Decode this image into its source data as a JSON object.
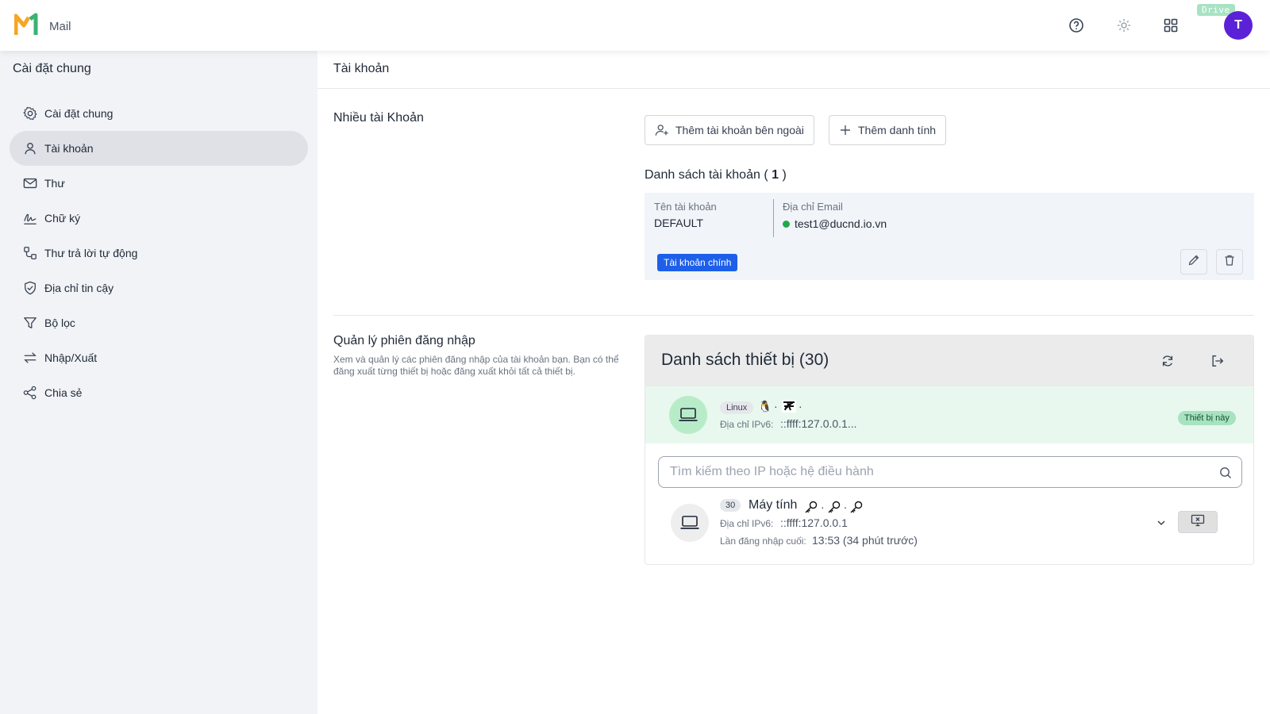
{
  "app": {
    "name": "Mail",
    "drive_badge": "Drive",
    "avatar_letter": "T",
    "brand_orange": "#f5a623",
    "brand_green": "#3bb273",
    "avatar_color": "#5b21d6"
  },
  "topbar": {
    "icons": [
      "help-icon",
      "settings-icon",
      "apps-grid-icon"
    ]
  },
  "sidebar": {
    "title": "Cài đặt chung",
    "items": [
      {
        "label": "Cài đặt chung",
        "icon": "gear-icon"
      },
      {
        "label": "Tài khoản",
        "icon": "user-icon",
        "active": true
      },
      {
        "label": "Thư",
        "icon": "mail-icon"
      },
      {
        "label": "Chữ ký",
        "icon": "signature-icon"
      },
      {
        "label": "Thư trả lời tự động",
        "icon": "auto-reply-icon"
      },
      {
        "label": "Địa chỉ tin cậy",
        "icon": "shield-icon"
      },
      {
        "label": "Bộ lọc",
        "icon": "filter-icon"
      },
      {
        "label": "Nhập/Xuất",
        "icon": "import-export-icon"
      },
      {
        "label": "Chia sẻ",
        "icon": "share-icon"
      }
    ]
  },
  "main": {
    "title": "Tài khoản",
    "multi_account": {
      "label": "Nhiều tài Khoản",
      "add_external_label": "Thêm tài khoản bên ngoài",
      "add_identity_label": "Thêm danh tính",
      "list_title_prefix": "Danh sách tài khoản (",
      "list_count": "1",
      "list_title_suffix": ")",
      "col_name_label": "Tên tài khoản",
      "col_email_label": "Địa chỉ Email",
      "account_name": "DEFAULT",
      "account_email": "test1@ducnd.io.vn",
      "primary_badge": "Tài khoản chính"
    },
    "sessions": {
      "label": "Quản lý phiên đăng nhập",
      "description": "Xem và quản lý các phiên đăng nhập của tài khoản bạn. Bạn có thể đăng xuất từng thiết bị hoặc đăng xuất khỏi tất cả thiết bị.",
      "panel_title": "Danh sách thiết bị (30)",
      "current": {
        "os": "Linux",
        "ipv6_label": "Địa chỉ IPv6:",
        "ipv6_value": "::ffff:127.0.0.1...",
        "this_device_badge": "Thiết bị này"
      },
      "search_placeholder": "Tìm kiếm theo IP hoặc hệ điều hành",
      "group": {
        "count": "30",
        "name": "Máy tính",
        "ipv6_label": "Địa chỉ IPv6:",
        "ipv6_value": "::ffff:127.0.0.1",
        "last_login_label": "Lần đăng nhập cuối:",
        "last_login_value": "13:53 (34 phút trước)"
      }
    }
  }
}
